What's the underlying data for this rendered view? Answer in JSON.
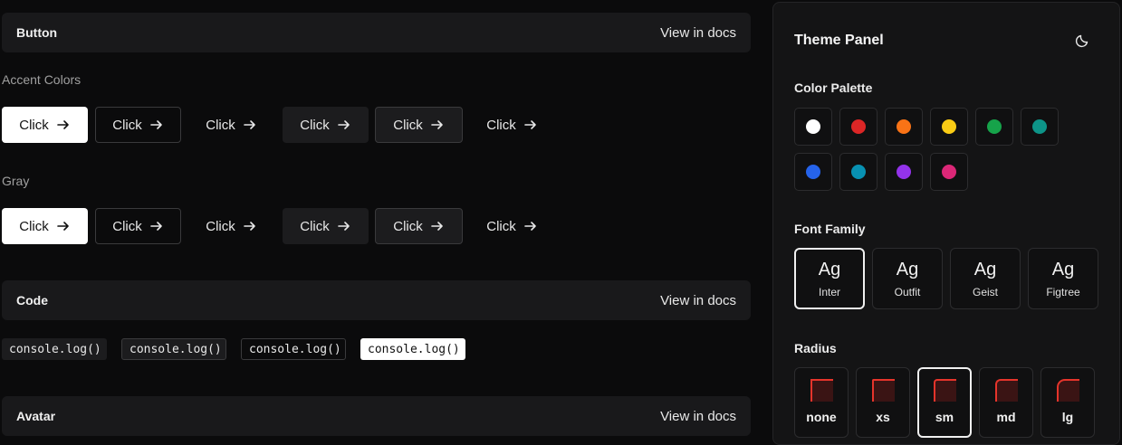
{
  "sections": {
    "button": {
      "title": "Button",
      "docs_label": "View in docs"
    },
    "code": {
      "title": "Code",
      "docs_label": "View in docs"
    },
    "avatar": {
      "title": "Avatar",
      "docs_label": "View in docs"
    }
  },
  "button_groups": {
    "accent": {
      "label": "Accent Colors",
      "buttons": [
        "Click",
        "Click",
        "Click",
        "Click",
        "Click",
        "Click"
      ]
    },
    "gray": {
      "label": "Gray",
      "buttons": [
        "Click",
        "Click",
        "Click",
        "Click",
        "Click",
        "Click"
      ]
    }
  },
  "code_samples": [
    "console.log()",
    "console.log()",
    "console.log()",
    "console.log()"
  ],
  "theme_panel": {
    "title": "Theme Panel",
    "theme_toggle_icon": "moon-icon",
    "color_palette": {
      "label": "Color Palette",
      "colors": [
        "#ffffff",
        "#dc2626",
        "#f97316",
        "#facc15",
        "#16a34a",
        "#0d9488",
        "#2563eb",
        "#0891b2",
        "#9333ea",
        "#db2777"
      ]
    },
    "font_family": {
      "label": "Font Family",
      "sample": "Ag",
      "options": [
        "Inter",
        "Outfit",
        "Geist",
        "Figtree"
      ],
      "selected": "Inter"
    },
    "radius": {
      "label": "Radius",
      "options": [
        "none",
        "xs",
        "sm",
        "md",
        "lg"
      ],
      "selected": "sm"
    }
  }
}
